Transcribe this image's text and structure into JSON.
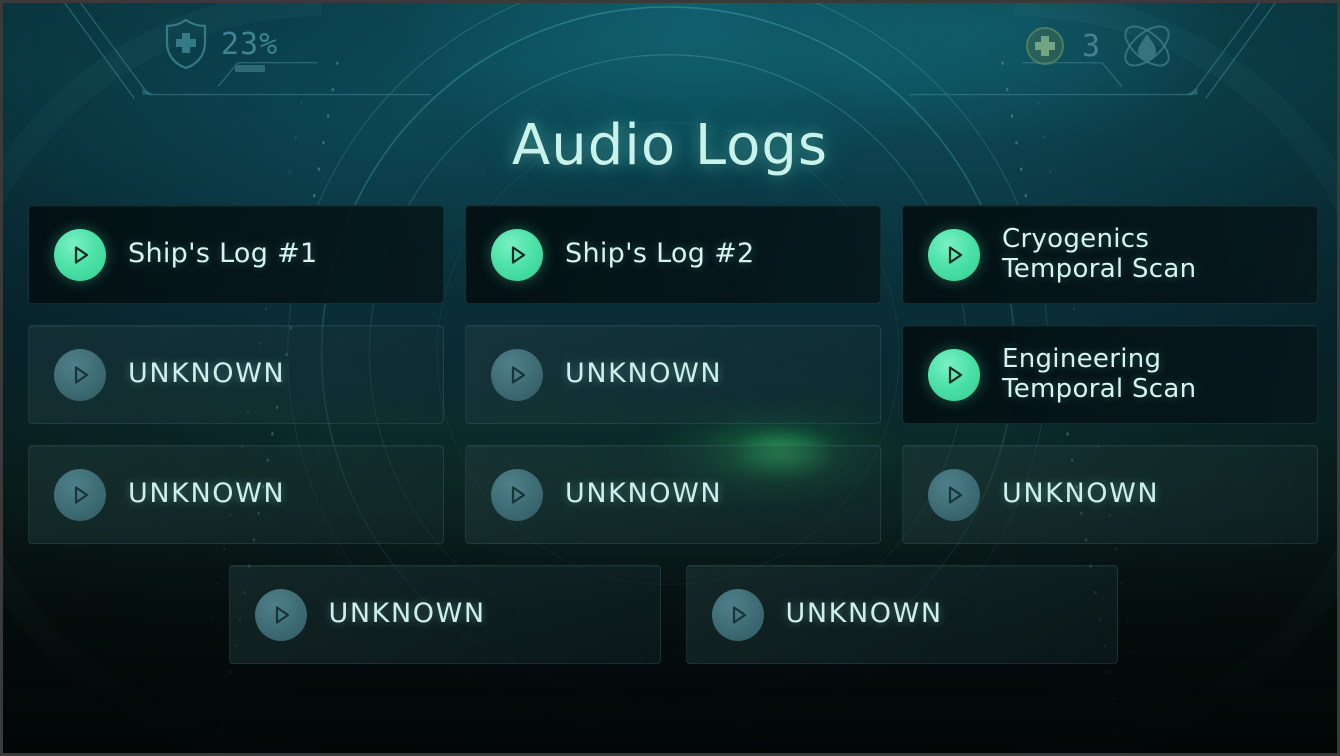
{
  "screen": {
    "title": "Audio Logs",
    "accent_mint": "#4ee2a8",
    "accent_text": "#d6f5ef",
    "locked_circle": "#3f6d76",
    "bg_top": "#0e4f5c",
    "bg_bottom": "#040a0a"
  },
  "hud": {
    "health_icon": "shield-plus-icon",
    "health_value": "23%",
    "medkit_icon": "medkit-circle-icon",
    "medkit_count": "3",
    "resource_icon": "atom-droplet-icon"
  },
  "logs": {
    "rows": [
      [
        {
          "label": "Ship's Log #1",
          "state": "unlocked",
          "icon": "play-icon",
          "lines": 1
        },
        {
          "label": "Ship's Log #2",
          "state": "unlocked",
          "icon": "play-icon",
          "lines": 1
        },
        {
          "label": "Cryogenics\nTemporal Scan",
          "state": "unlocked",
          "icon": "play-icon",
          "lines": 2
        }
      ],
      [
        {
          "label": "UNKNOWN",
          "state": "locked",
          "icon": "play-icon",
          "lines": 1
        },
        {
          "label": "UNKNOWN",
          "state": "locked",
          "icon": "play-icon",
          "lines": 1
        },
        {
          "label": "Engineering\nTemporal Scan",
          "state": "unlocked",
          "icon": "play-icon",
          "lines": 2
        }
      ],
      [
        {
          "label": "UNKNOWN",
          "state": "locked",
          "icon": "play-icon",
          "lines": 1
        },
        {
          "label": "UNKNOWN",
          "state": "locked",
          "icon": "play-icon",
          "lines": 1
        },
        {
          "label": "UNKNOWN",
          "state": "locked",
          "icon": "play-icon",
          "lines": 1
        }
      ],
      [
        {
          "label": "UNKNOWN",
          "state": "locked",
          "icon": "play-icon",
          "lines": 1
        },
        {
          "label": "UNKNOWN",
          "state": "locked",
          "icon": "play-icon",
          "lines": 1
        }
      ]
    ]
  }
}
